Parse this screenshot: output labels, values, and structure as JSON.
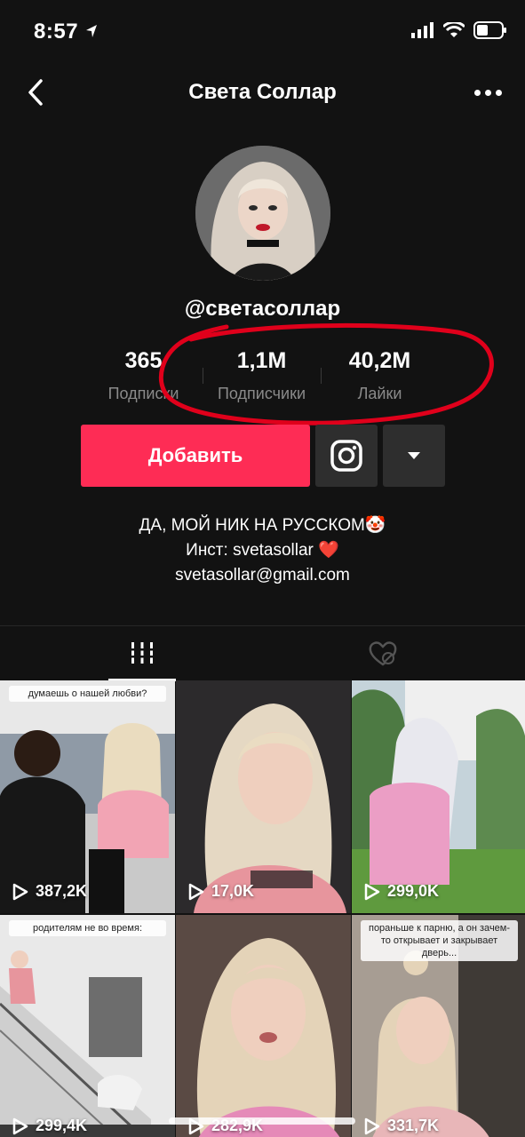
{
  "status": {
    "time": "8:57"
  },
  "nav": {
    "title": "Света Соллар"
  },
  "profile": {
    "username": "@светасоллар",
    "stats": [
      {
        "value": "365",
        "label": "Подписки"
      },
      {
        "value": "1,1M",
        "label": "Подписчики"
      },
      {
        "value": "40,2M",
        "label": "Лайки"
      }
    ],
    "follow_label": "Добавить",
    "bio": {
      "line1": "ДА, МОЙ НИК НА РУССКОМ🤡",
      "line2": "Инст: svetasollar ❤️",
      "line3": "svetasollar@gmail.com"
    }
  },
  "videos": [
    {
      "views": "387,2K",
      "caption": "думаешь о нашей любви?"
    },
    {
      "views": "17,0K",
      "caption": ""
    },
    {
      "views": "299,0K",
      "caption": ""
    },
    {
      "views": "299,4K",
      "caption": "родителям не во время:"
    },
    {
      "views": "282,9K",
      "caption": ""
    },
    {
      "views": "331,7K",
      "caption": "пораньше к парню, а он зачем-то открывает и закрывает дверь..."
    }
  ],
  "colors": {
    "accent": "#fe2c55",
    "background": "#121212",
    "annotation": "#e0001b"
  },
  "icons": [
    "back-chevron-icon",
    "more-dots-icon",
    "instagram-icon",
    "dropdown-arrow-icon",
    "grid-icon",
    "liked-hidden-icon",
    "play-icon"
  ]
}
